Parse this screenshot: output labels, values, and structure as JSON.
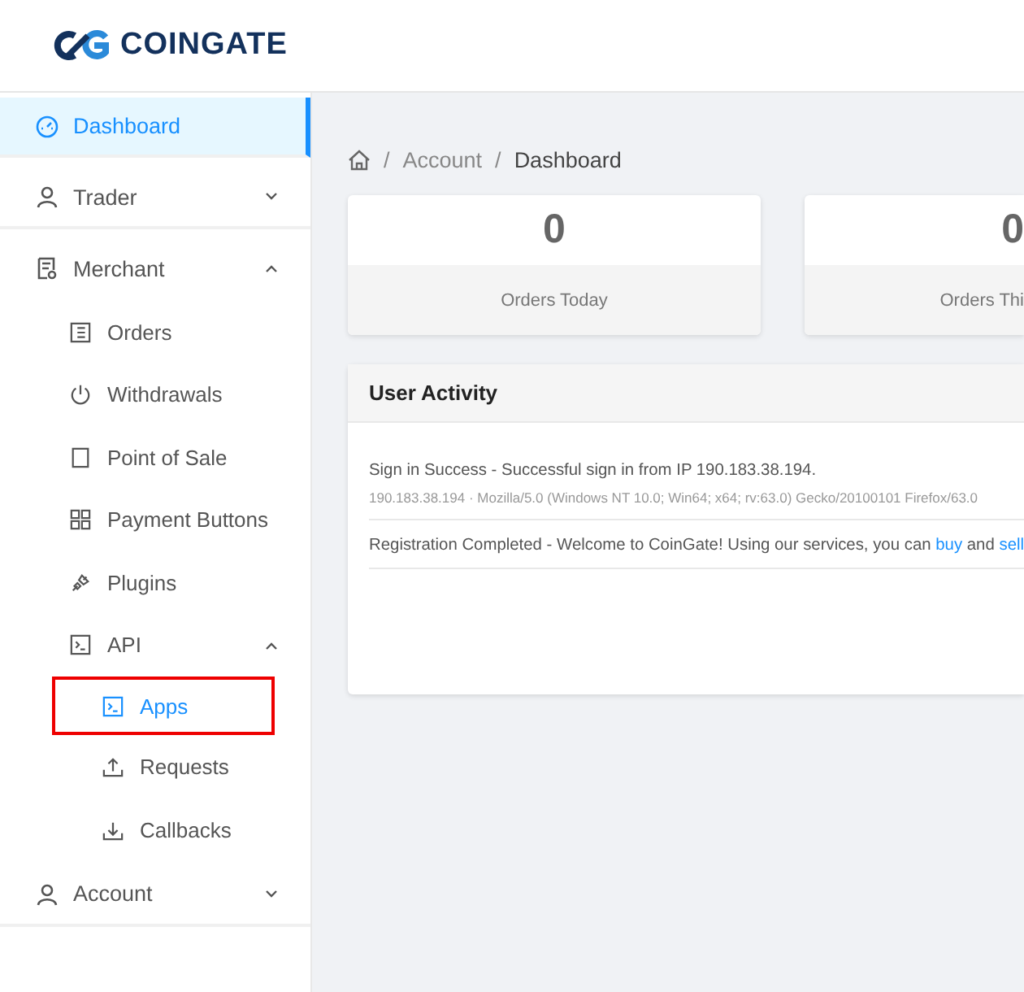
{
  "logo": {
    "text": "COINGATE"
  },
  "sidebar": {
    "items": [
      {
        "label": "Dashboard",
        "selected": true
      },
      {
        "label": "Trader",
        "selected": false,
        "expanded": false
      },
      {
        "label": "Merchant",
        "selected": false,
        "expanded": true,
        "children": [
          {
            "label": "Orders",
            "selected": false,
            "highlighted": false
          },
          {
            "label": "Withdrawals",
            "selected": false,
            "highlighted": false
          },
          {
            "label": "Point of Sale",
            "selected": false,
            "highlighted": false
          },
          {
            "label": "Payment Buttons",
            "selected": false,
            "highlighted": false
          },
          {
            "label": "Plugins",
            "selected": false,
            "highlighted": false
          },
          {
            "label": "API",
            "selected": false,
            "highlighted": false,
            "expanded": true,
            "children": [
              {
                "label": "Apps",
                "selected": true,
                "highlighted": true
              },
              {
                "label": "Requests",
                "selected": false,
                "highlighted": false
              },
              {
                "label": "Callbacks",
                "selected": false,
                "highlighted": false
              }
            ]
          }
        ]
      },
      {
        "label": "Account",
        "selected": false,
        "expanded": false
      }
    ]
  },
  "breadcrumb": [
    {
      "separator": "/",
      "label": "Account"
    },
    {
      "separator": "/",
      "label": "Dashboard"
    }
  ],
  "stats": [
    {
      "value": "0",
      "label": "Orders Today"
    },
    {
      "value": "0",
      "label": "Orders Thi"
    }
  ],
  "activity": {
    "title": "User Activity",
    "entries": [
      {
        "segments": [
          {
            "kind": "text",
            "text": "Sign in Success - Successful sign in from IP 190.183.38.194."
          }
        ],
        "detail": "190.183.38.194 · Mozilla/5.0 (Windows NT 10.0; Win64; x64; rv:63.0) Gecko/20100101 Firefox/63.0"
      },
      {
        "segments": [
          {
            "kind": "text",
            "text": "Registration Completed - Welcome to CoinGate! Using our services, you can "
          },
          {
            "kind": "link",
            "text": "buy"
          },
          {
            "kind": "text",
            "text": " and "
          },
          {
            "kind": "link",
            "text": "sell"
          }
        ]
      }
    ]
  }
}
